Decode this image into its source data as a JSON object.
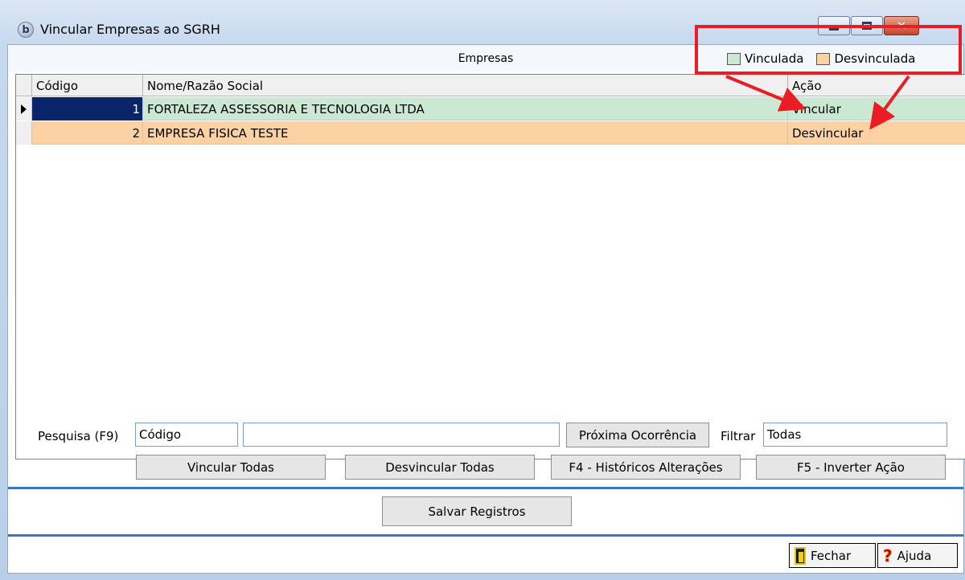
{
  "window": {
    "title": "Vincular Empresas ao SGRH",
    "app_icon_letter": "b"
  },
  "section": {
    "title": "Empresas"
  },
  "legend": [
    {
      "label": "Vinculada",
      "color": "#cbe8d3"
    },
    {
      "label": "Desvinculada",
      "color": "#fcd1a3"
    }
  ],
  "grid": {
    "columns": [
      "Código",
      "Nome/Razão Social",
      "Ação"
    ],
    "rows": [
      {
        "codigo": "1",
        "nome": "FORTALEZA ASSESSORIA E TECNOLOGIA LTDA",
        "acao": "Vincular",
        "color": "#cbe8d3",
        "selected": true
      },
      {
        "codigo": "2",
        "nome": "EMPRESA FISICA TESTE",
        "acao": "Desvincular",
        "color": "#fcd1a3",
        "selected": false
      }
    ]
  },
  "search": {
    "label": "Pesquisa (F9)",
    "field_value": "Código",
    "text_value": "",
    "next_button": "Próxima Ocorrência",
    "filter_label": "Filtrar",
    "filter_value": "Todas"
  },
  "actions": {
    "vincular_todas": "Vincular Todas",
    "desvincular_todas": "Desvincular Todas",
    "historicos": "F4 - Históricos Alterações",
    "inverter": "F5 - Inverter Ação"
  },
  "save": {
    "label": "Salvar Registros"
  },
  "footer": {
    "fechar": "Fechar",
    "ajuda": "Ajuda"
  },
  "colors": {
    "highlight": "#ea1c24",
    "separator": "#3e74c6",
    "selection": "#0a246a"
  }
}
